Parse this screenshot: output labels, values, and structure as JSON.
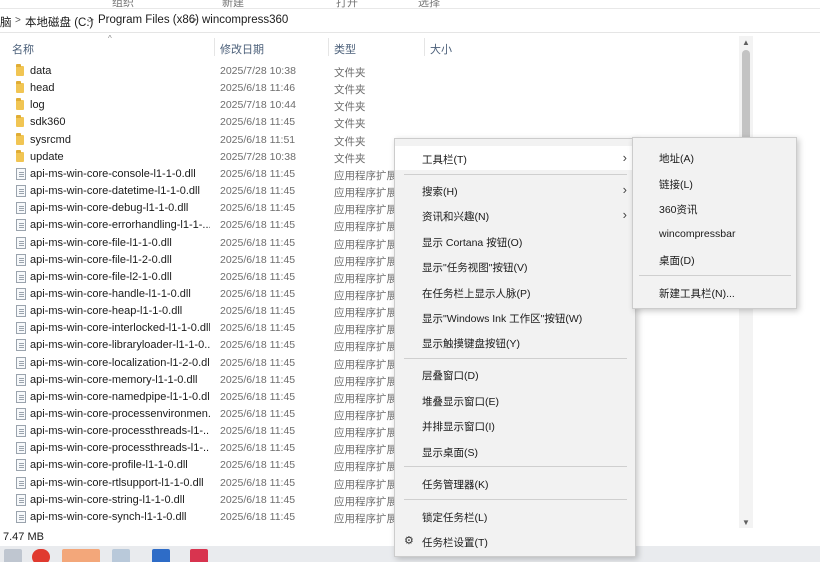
{
  "ribbon": {
    "labels": [
      "组织",
      "新建",
      "打开",
      "选择"
    ]
  },
  "breadcrumb": {
    "items": [
      "脑",
      "本地磁盘 (C:)",
      "Program Files (x86)",
      "wincompress360"
    ]
  },
  "columns": {
    "name": "名称",
    "date": "修改日期",
    "type": "类型",
    "size": "大小"
  },
  "files": [
    {
      "name": "data",
      "date": "2025/7/28 10:38",
      "type": "文件夹",
      "kind": "folder"
    },
    {
      "name": "head",
      "date": "2025/6/18 11:46",
      "type": "文件夹",
      "kind": "folder"
    },
    {
      "name": "log",
      "date": "2025/7/18 10:44",
      "type": "文件夹",
      "kind": "folder"
    },
    {
      "name": "sdk360",
      "date": "2025/6/18 11:45",
      "type": "文件夹",
      "kind": "folder"
    },
    {
      "name": "sysrcmd",
      "date": "2025/6/18 11:51",
      "type": "文件夹",
      "kind": "folder"
    },
    {
      "name": "update",
      "date": "2025/7/28 10:38",
      "type": "文件夹",
      "kind": "folder"
    },
    {
      "name": "api-ms-win-core-console-l1-1-0.dll",
      "date": "2025/6/18 11:45",
      "type": "应用程序扩展",
      "kind": "dll"
    },
    {
      "name": "api-ms-win-core-datetime-l1-1-0.dll",
      "date": "2025/6/18 11:45",
      "type": "应用程序扩展",
      "kind": "dll"
    },
    {
      "name": "api-ms-win-core-debug-l1-1-0.dll",
      "date": "2025/6/18 11:45",
      "type": "应用程序扩展",
      "kind": "dll"
    },
    {
      "name": "api-ms-win-core-errorhandling-l1-1-...",
      "date": "2025/6/18 11:45",
      "type": "应用程序扩展",
      "kind": "dll"
    },
    {
      "name": "api-ms-win-core-file-l1-1-0.dll",
      "date": "2025/6/18 11:45",
      "type": "应用程序扩展",
      "kind": "dll"
    },
    {
      "name": "api-ms-win-core-file-l1-2-0.dll",
      "date": "2025/6/18 11:45",
      "type": "应用程序扩展",
      "kind": "dll"
    },
    {
      "name": "api-ms-win-core-file-l2-1-0.dll",
      "date": "2025/6/18 11:45",
      "type": "应用程序扩展",
      "kind": "dll"
    },
    {
      "name": "api-ms-win-core-handle-l1-1-0.dll",
      "date": "2025/6/18 11:45",
      "type": "应用程序扩展",
      "kind": "dll"
    },
    {
      "name": "api-ms-win-core-heap-l1-1-0.dll",
      "date": "2025/6/18 11:45",
      "type": "应用程序扩展",
      "kind": "dll"
    },
    {
      "name": "api-ms-win-core-interlocked-l1-1-0.dll",
      "date": "2025/6/18 11:45",
      "type": "应用程序扩展",
      "kind": "dll"
    },
    {
      "name": "api-ms-win-core-libraryloader-l1-1-0...",
      "date": "2025/6/18 11:45",
      "type": "应用程序扩展",
      "kind": "dll"
    },
    {
      "name": "api-ms-win-core-localization-l1-2-0.dll",
      "date": "2025/6/18 11:45",
      "type": "应用程序扩展",
      "kind": "dll"
    },
    {
      "name": "api-ms-win-core-memory-l1-1-0.dll",
      "date": "2025/6/18 11:45",
      "type": "应用程序扩展",
      "kind": "dll"
    },
    {
      "name": "api-ms-win-core-namedpipe-l1-1-0.dll",
      "date": "2025/6/18 11:45",
      "type": "应用程序扩展",
      "kind": "dll"
    },
    {
      "name": "api-ms-win-core-processenvironmen...",
      "date": "2025/6/18 11:45",
      "type": "应用程序扩展",
      "kind": "dll"
    },
    {
      "name": "api-ms-win-core-processthreads-l1-...",
      "date": "2025/6/18 11:45",
      "type": "应用程序扩展",
      "kind": "dll"
    },
    {
      "name": "api-ms-win-core-processthreads-l1-...",
      "date": "2025/6/18 11:45",
      "type": "应用程序扩展",
      "kind": "dll"
    },
    {
      "name": "api-ms-win-core-profile-l1-1-0.dll",
      "date": "2025/6/18 11:45",
      "type": "应用程序扩展",
      "kind": "dll"
    },
    {
      "name": "api-ms-win-core-rtlsupport-l1-1-0.dll",
      "date": "2025/6/18 11:45",
      "type": "应用程序扩展",
      "kind": "dll"
    },
    {
      "name": "api-ms-win-core-string-l1-1-0.dll",
      "date": "2025/6/18 11:45",
      "type": "应用程序扩展",
      "kind": "dll"
    },
    {
      "name": "api-ms-win-core-synch-l1-1-0.dll",
      "date": "2025/6/18 11:45",
      "type": "应用程序扩展",
      "kind": "dll"
    }
  ],
  "status": {
    "size": "7.47 MB"
  },
  "context_menu": {
    "toolbars": "工具栏(T)",
    "search": "搜索(H)",
    "news": "资讯和兴趣(N)",
    "cortana": "显示 Cortana 按钮(O)",
    "taskview": "显示\"任务视图\"按钮(V)",
    "people": "在任务栏上显示人脉(P)",
    "ink": "显示\"Windows Ink 工作区\"按钮(W)",
    "touch_keyboard": "显示触摸键盘按钮(Y)",
    "cascade": "层叠窗口(D)",
    "stack": "堆叠显示窗口(E)",
    "side_by_side": "并排显示窗口(I)",
    "show_desktop": "显示桌面(S)",
    "task_manager": "任务管理器(K)",
    "lock_taskbar": "锁定任务栏(L)",
    "settings": "任务栏设置(T)"
  },
  "submenu": {
    "address": "地址(A)",
    "links": "链接(L)",
    "news360": "360资讯",
    "wincompressbar": "wincompressbar",
    "desktop": "桌面(D)",
    "new_toolbar": "新建工具栏(N)..."
  },
  "colors": {
    "folder": "#f1c553",
    "menu_bg": "#f2f2f2",
    "taskbar": "#e9ebee"
  }
}
